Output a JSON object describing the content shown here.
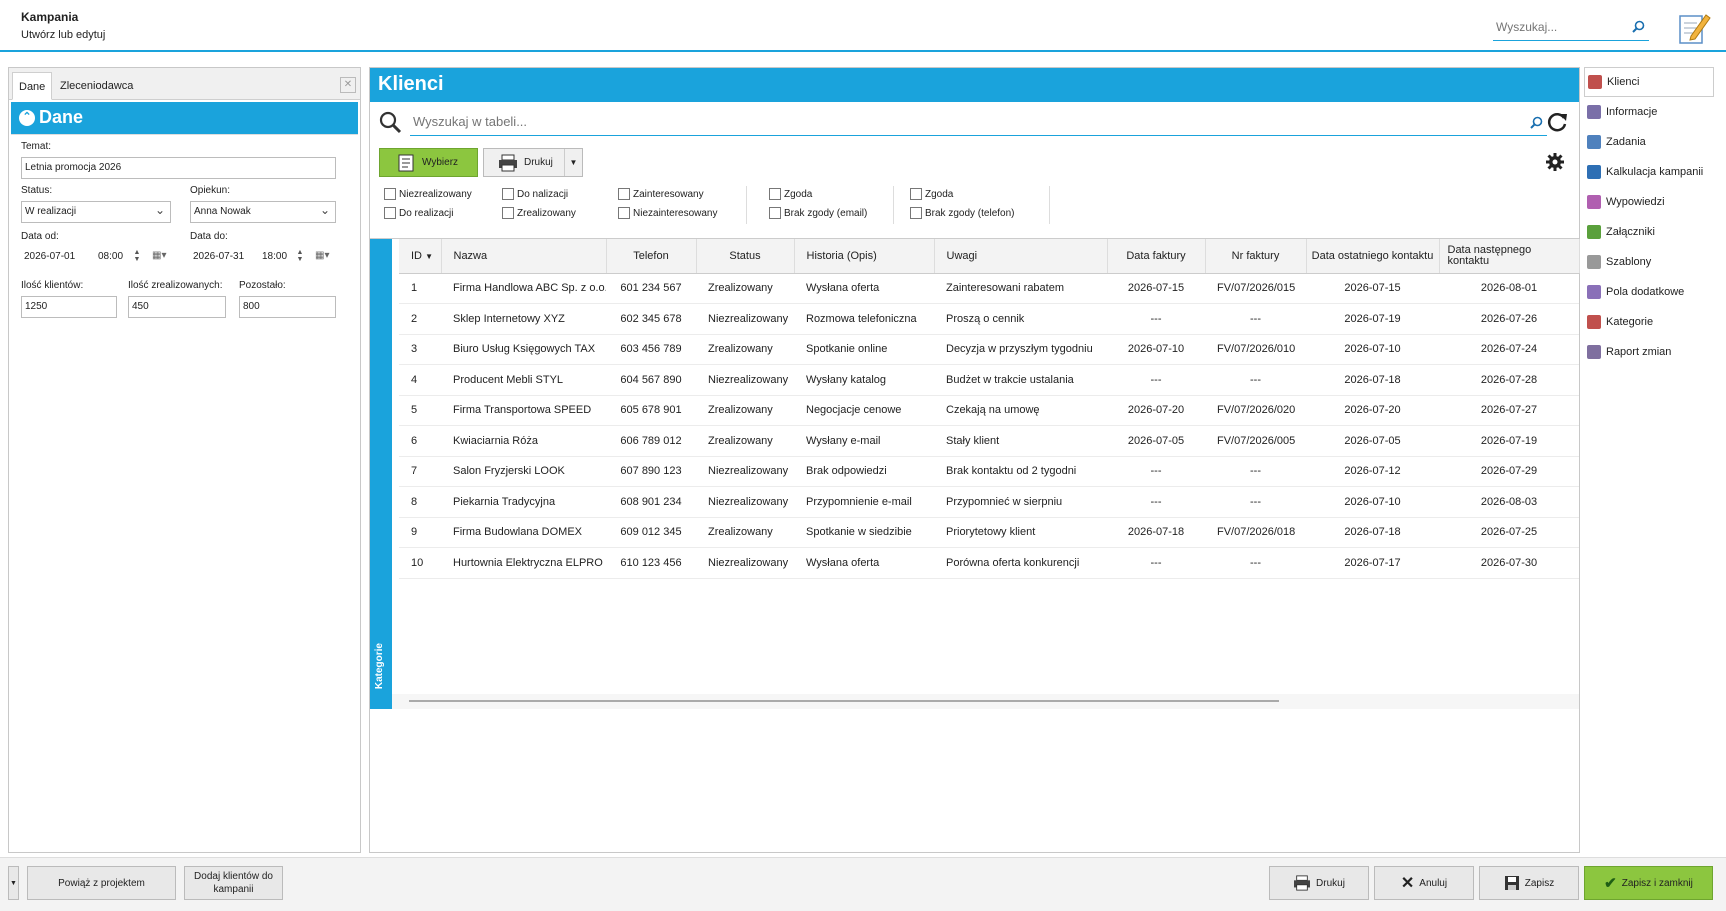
{
  "header": {
    "title": "Kampania",
    "subtitle": "Utwórz lub edytuj",
    "search_placeholder": "Wyszukaj..."
  },
  "left": {
    "tabs": [
      "Dane",
      "Zleceniodawca"
    ],
    "section_title": "Dane",
    "temat_label": "Temat:",
    "temat_value": "Letnia promocja 2026",
    "status_label": "Status:",
    "status_value": "W realizacji",
    "opiekun_label": "Opiekun:",
    "opiekun_value": "Anna Nowak",
    "data_od_label": "Data od:",
    "data_od_date": "2026-07-01",
    "data_od_time": "08:00",
    "data_do_label": "Data do:",
    "data_do_date": "2026-07-31",
    "data_do_time": "18:00",
    "ilosc_label": "Ilość klientów:",
    "ilosc_value": "1250",
    "zreal_label": "Ilość zrealizowanych:",
    "zreal_value": "450",
    "pozostalo_label": "Pozostało:",
    "pozostalo_value": "800"
  },
  "main": {
    "title": "Klienci",
    "search_placeholder": "Wyszukaj w tabeli...",
    "btn_wybierz": "Wybierz",
    "btn_drukuj": "Drukuj",
    "filters": [
      "Niezrealizowany",
      "Do realizacji",
      "Do nalizacji",
      "Zrealizowany",
      "Zainteresowany",
      "Niezainteresowany",
      "Zgoda",
      "Brak zgody (email)",
      "Zgoda",
      "Brak zgody (telefon)"
    ],
    "kategorie": "Kategorie",
    "columns": [
      "ID",
      "Nazwa",
      "Telefon",
      "Status",
      "Historia (Opis)",
      "Uwagi",
      "Data faktury",
      "Nr faktury",
      "Data ostatniego kontaktu",
      "Data następnego kontaktu"
    ],
    "rows": [
      [
        "1",
        "Firma Handlowa ABC Sp. z o.o.",
        "601 234 567",
        "Zrealizowany",
        "Wysłana oferta",
        "Zainteresowani rabatem",
        "2026-07-15",
        "FV/07/2026/015",
        "2026-07-15",
        "2026-08-01"
      ],
      [
        "2",
        "Sklep Internetowy XYZ",
        "602 345 678",
        "Niezrealizowany",
        "Rozmowa telefoniczna",
        "Proszą o cennik",
        "---",
        "---",
        "2026-07-19",
        "2026-07-26"
      ],
      [
        "3",
        "Biuro Usług Księgowych TAX",
        "603 456 789",
        "Zrealizowany",
        "Spotkanie online",
        "Decyzja w przyszłym tygodniu",
        "2026-07-10",
        "FV/07/2026/010",
        "2026-07-10",
        "2026-07-24"
      ],
      [
        "4",
        "Producent Mebli STYL",
        "604 567 890",
        "Niezrealizowany",
        "Wysłany katalog",
        "Budżet w trakcie ustalania",
        "---",
        "---",
        "2026-07-18",
        "2026-07-28"
      ],
      [
        "5",
        "Firma Transportowa SPEED",
        "605 678 901",
        "Zrealizowany",
        "Negocjacje cenowe",
        "Czekają na umowę",
        "2026-07-20",
        "FV/07/2026/020",
        "2026-07-20",
        "2026-07-27"
      ],
      [
        "6",
        "Kwiaciarnia Róża",
        "606 789 012",
        "Zrealizowany",
        "Wysłany e-mail",
        "Stały klient",
        "2026-07-05",
        "FV/07/2026/005",
        "2026-07-05",
        "2026-07-19"
      ],
      [
        "7",
        "Salon Fryzjerski LOOK",
        "607 890 123",
        "Niezrealizowany",
        "Brak odpowiedzi",
        "Brak kontaktu od 2 tygodni",
        "---",
        "---",
        "2026-07-12",
        "2026-07-29"
      ],
      [
        "8",
        "Piekarnia Tradycyjna",
        "608 901 234",
        "Niezrealizowany",
        "Przypomnienie e-mail",
        "Przypomnieć w sierpniu",
        "---",
        "---",
        "2026-07-10",
        "2026-08-03"
      ],
      [
        "9",
        "Firma Budowlana DOMEX",
        "609 012 345",
        "Zrealizowany",
        "Spotkanie w siedzibie",
        "Priorytetowy klient",
        "2026-07-18",
        "FV/07/2026/018",
        "2026-07-18",
        "2026-07-25"
      ],
      [
        "10",
        "Hurtownia Elektryczna ELPRO",
        "610 123 456",
        "Niezrealizowany",
        "Wysłana oferta",
        "Porówna oferta konkurencji",
        "---",
        "---",
        "2026-07-17",
        "2026-07-30"
      ]
    ]
  },
  "sidebar": {
    "items": [
      {
        "label": "Klienci",
        "icon": "clients-icon",
        "color": "#c0504d"
      },
      {
        "label": "Informacje",
        "icon": "info-icon",
        "color": "#7a6fa8"
      },
      {
        "label": "Zadania",
        "icon": "tasks-icon",
        "color": "#4f81bd"
      },
      {
        "label": "Kalkulacja kampanii",
        "icon": "calculator-icon",
        "color": "#2e6fb4"
      },
      {
        "label": "Wypowiedzi",
        "icon": "speech-icon",
        "color": "#b05fb0"
      },
      {
        "label": "Załączniki",
        "icon": "paperclip-icon",
        "color": "#5aa03c"
      },
      {
        "label": "Szablony",
        "icon": "template-icon",
        "color": "#999999"
      },
      {
        "label": "Pola dodatkowe",
        "icon": "fields-icon",
        "color": "#8a70b8"
      },
      {
        "label": "Kategorie",
        "icon": "categories-icon",
        "color": "#c0504d"
      },
      {
        "label": "Raport zmian",
        "icon": "report-icon",
        "color": "#7f6f9f"
      }
    ]
  },
  "bottom": {
    "btn_powiaz": "Powiąż z projektem",
    "btn_dodaj": "Dodaj klientów do kampanii",
    "btn_drukuj": "Drukuj",
    "btn_anuluj": "Anuluj",
    "btn_zapisz": "Zapisz",
    "btn_zapisz_zamknij": "Zapisz i zamknij"
  },
  "colors": {
    "accent": "#1aa3dc",
    "green": "#8cc63f"
  }
}
